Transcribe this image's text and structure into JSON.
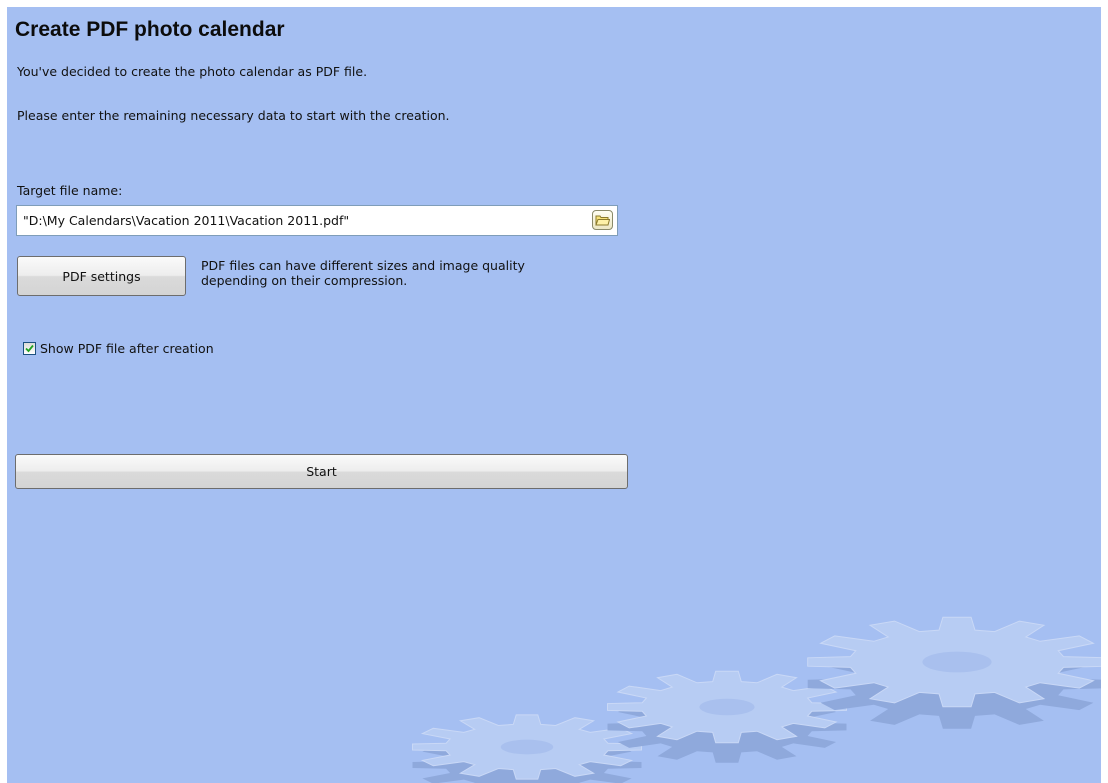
{
  "page": {
    "title": "Create PDF photo calendar",
    "intro_line1": "You've decided to create the photo calendar as PDF file.",
    "intro_line2": "Please enter the remaining necessary data to start with the creation."
  },
  "target_file": {
    "label": "Target file name:",
    "value": "\"D:\\My Calendars\\Vacation 2011\\Vacation 2011.pdf\"",
    "browse_icon": "folder-icon"
  },
  "pdf_settings": {
    "button_label": "PDF settings",
    "description_line1": "PDF files can have different sizes and image quality",
    "description_line2": "depending on their compression."
  },
  "show_pdf": {
    "label": "Show PDF file after creation",
    "checked": true
  },
  "start": {
    "button_label": "Start"
  },
  "colors": {
    "background": "#a5bff2",
    "gear": "#b7ccf3"
  }
}
